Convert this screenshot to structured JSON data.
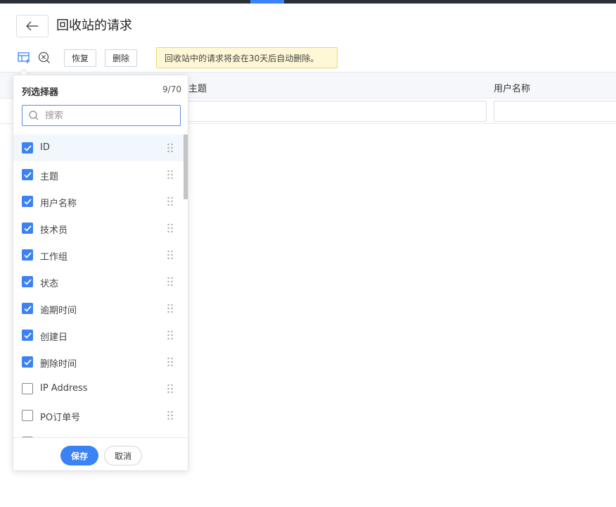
{
  "colors": {
    "accent": "#3b82f6",
    "notice_bg": "#fff8d6",
    "notice_border": "#f2d46b",
    "topbar": "#2b2f36"
  },
  "header": {
    "title": "回收站的请求",
    "back_icon": "arrow-left-icon"
  },
  "toolbar": {
    "column_picker_icon": "table-columns-icon",
    "clear_filter_icon": "search-clear-icon",
    "restore_label": "恢复",
    "delete_label": "删除",
    "notice": "回收站中的请求将会在30天后自动删除。"
  },
  "table": {
    "columns": [
      "主题",
      "用户名称"
    ]
  },
  "column_picker": {
    "title": "列选择器",
    "count": "9/70",
    "search_placeholder": "搜索",
    "items": [
      {
        "label": "ID",
        "checked": true
      },
      {
        "label": "主题",
        "checked": true
      },
      {
        "label": "用户名称",
        "checked": true
      },
      {
        "label": "技术员",
        "checked": true
      },
      {
        "label": "工作组",
        "checked": true
      },
      {
        "label": "状态",
        "checked": true
      },
      {
        "label": "逾期时间",
        "checked": true
      },
      {
        "label": "创建日",
        "checked": true
      },
      {
        "label": "删除时间",
        "checked": true
      },
      {
        "label": "IP Address",
        "checked": false
      },
      {
        "label": "PO订单号",
        "checked": false
      },
      {
        "label": "",
        "checked": false
      }
    ],
    "save_label": "保存",
    "cancel_label": "取消"
  }
}
